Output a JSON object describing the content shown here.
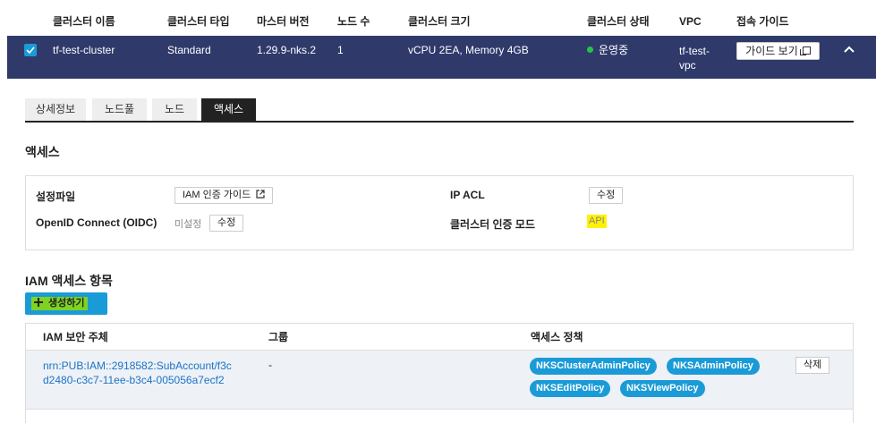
{
  "table_header": {
    "name": "클러스터 이름",
    "type": "클러스터 타입",
    "master_version": "마스터 버전",
    "node_count": "노드 수",
    "size": "클러스터 크기",
    "status": "클러스터 상태",
    "vpc": "VPC",
    "guide": "접속 가이드"
  },
  "cluster": {
    "name": "tf-test-cluster",
    "type": "Standard",
    "master_version": "1.29.9-nks.2",
    "node_count": "1",
    "size": "vCPU 2EA, Memory 4GB",
    "status": "운영중",
    "status_color": "#27c24c",
    "vpc": "tf-test-vpc",
    "guide_button": "가이드 보기",
    "selected": true
  },
  "tabs": [
    {
      "label": "상세정보",
      "active": false
    },
    {
      "label": "노드풀",
      "active": false
    },
    {
      "label": "노드",
      "active": false
    },
    {
      "label": "액세스",
      "active": true
    }
  ],
  "access": {
    "title": "액세스",
    "config_file_label": "설정파일",
    "iam_guide_button": "IAM 인증 가이드",
    "ip_acl_label": "IP ACL",
    "ip_acl_edit": "수정",
    "oidc_label": "OpenID Connect (OIDC)",
    "oidc_value": "미설정",
    "oidc_edit": "수정",
    "auth_mode_label": "클러스터 인증 모드",
    "auth_mode_value": "API"
  },
  "iam": {
    "title": "IAM 액세스 항목",
    "create_button": "생성하기",
    "columns": [
      "IAM 보안 주체",
      "그룹",
      "액세스 정책"
    ],
    "rows": [
      {
        "principal": "nrn:PUB:IAM::2918582:SubAccount/f3cd2480-c3c7-11ee-b3c4-005056a7ecf2",
        "group": "-",
        "policies": [
          "NKSClusterAdminPolicy",
          "NKSAdminPolicy",
          "NKSEditPolicy",
          "NKSViewPolicy"
        ],
        "delete_button": "삭제"
      }
    ]
  },
  "colors": {
    "header_row_bg": "#2f3a6b",
    "accent": "#1a9bd7",
    "highlight_yellow": "#fff200",
    "highlight_green": "#7ed321"
  }
}
